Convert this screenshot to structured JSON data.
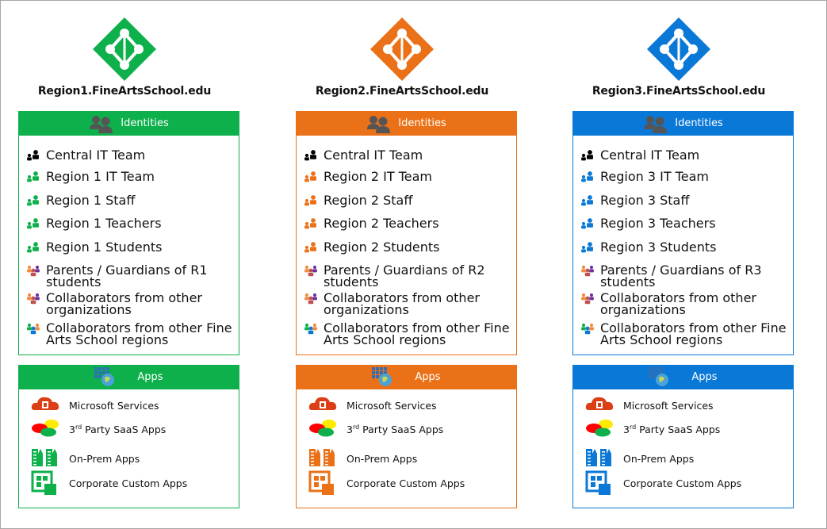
{
  "identities_label": "Identities",
  "apps_label": "Apps",
  "regions": [
    {
      "domain": "Region1.FineArtsSchool.edu",
      "color": "#0db04b",
      "identities": [
        {
          "label": "Central IT Team",
          "icon": "central-it-icon"
        },
        {
          "label": "Region 1 IT Team",
          "icon": "region-group-icon"
        },
        {
          "label": "Region 1 Staff",
          "icon": "region-group-icon"
        },
        {
          "label": "Region 1 Teachers",
          "icon": "region-group-icon"
        },
        {
          "label": "Region 1 Students",
          "icon": "region-group-icon"
        },
        {
          "label": "Parents / Guardians of R1 students",
          "icon": "parents-icon"
        },
        {
          "label": "Collaborators from other organizations",
          "icon": "external-collaborators-icon"
        },
        {
          "label": "Collaborators from other Fine Arts School regions",
          "icon": "region-collaborators-icon"
        }
      ]
    },
    {
      "domain": "Region2.FineArtsSchool.edu",
      "color": "#ea7117",
      "identities": [
        {
          "label": "Central IT Team",
          "icon": "central-it-icon"
        },
        {
          "label": "Region 2 IT Team",
          "icon": "region-group-icon"
        },
        {
          "label": "Region 2 Staff",
          "icon": "region-group-icon"
        },
        {
          "label": "Region 2 Teachers",
          "icon": "region-group-icon"
        },
        {
          "label": "Region 2 Students",
          "icon": "region-group-icon"
        },
        {
          "label": "Parents / Guardians of R2 students",
          "icon": "parents-icon"
        },
        {
          "label": "Collaborators from other organizations",
          "icon": "external-collaborators-icon"
        },
        {
          "label": "Collaborators from other Fine Arts School regions",
          "icon": "region-collaborators-icon"
        }
      ]
    },
    {
      "domain": "Region3.FineArtsSchool.edu",
      "color": "#0a78d7",
      "identities": [
        {
          "label": "Central IT Team",
          "icon": "central-it-icon"
        },
        {
          "label": "Region 3 IT Team",
          "icon": "region-group-icon"
        },
        {
          "label": "Region 3 Staff",
          "icon": "region-group-icon"
        },
        {
          "label": "Region 3 Teachers",
          "icon": "region-group-icon"
        },
        {
          "label": "Region 3 Students",
          "icon": "region-group-icon"
        },
        {
          "label": "Parents / Guardians of R3 students",
          "icon": "parents-icon"
        },
        {
          "label": "Collaborators from other organizations",
          "icon": "external-collaborators-icon"
        },
        {
          "label": "Collaborators from other Fine Arts School regions",
          "icon": "region-collaborators-icon"
        }
      ]
    }
  ],
  "apps": [
    {
      "label": "Microsoft Services",
      "icon": "office-cloud-icon"
    },
    {
      "label_main": "3",
      "label_sup": "rd",
      "label_rest": " Party SaaS Apps",
      "icon": "saas-clouds-icon"
    },
    {
      "label": "On-Prem Apps",
      "icon": "buildings-icon"
    },
    {
      "label": "Corporate Custom Apps",
      "icon": "custom-app-icon"
    }
  ],
  "colors": {
    "office": "#dc3e15",
    "header_people_icon": "#555555",
    "border": "#a6a6a6"
  }
}
